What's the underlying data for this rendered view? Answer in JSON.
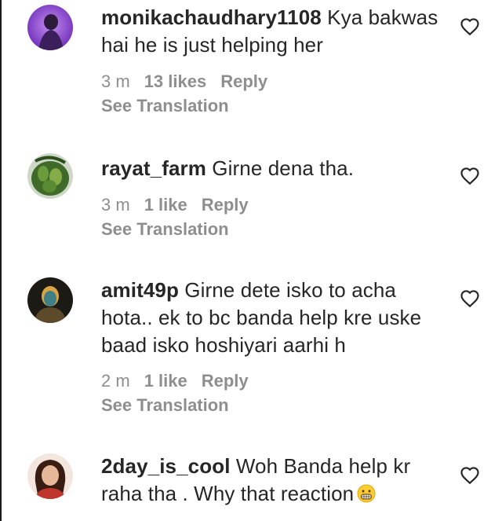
{
  "comments": [
    {
      "username": "monikachaudhary1108",
      "text": " Kya bakwas hai he is just helping her",
      "time": "3 m",
      "likes": "13 likes",
      "reply": "Reply",
      "translation": "See Translation"
    },
    {
      "username": "rayat_farm",
      "text": " Girne dena tha.",
      "time": "3 m",
      "likes": "1 like",
      "reply": "Reply",
      "translation": "See Translation"
    },
    {
      "username": "amit49p",
      "text": " Girne dete isko to acha hota.. ek to bc banda help kre uske baad isko hoshiyari aarhi h",
      "time": "2 m",
      "likes": "1 like",
      "reply": "Reply",
      "translation": "See Translation"
    },
    {
      "username": "2day_is_cool",
      "text": " Woh Banda help kr raha tha . Why that reaction",
      "emoji": "grimacing-face-emoji"
    }
  ],
  "icons": {
    "like": "heart-outline-icon"
  },
  "colors": {
    "text": "#262626",
    "muted": "#8e8e8e",
    "background": "#ffffff"
  }
}
